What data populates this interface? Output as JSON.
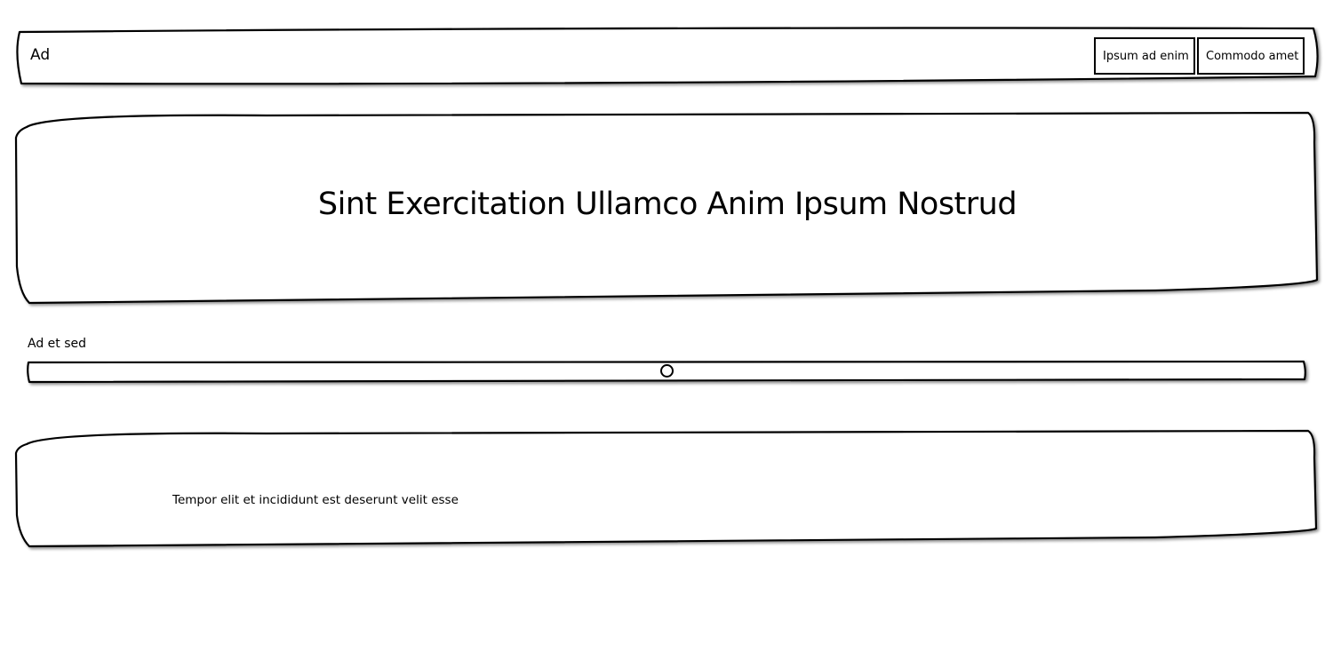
{
  "navbar": {
    "brand": "Ad",
    "buttons": [
      {
        "label": "Ipsum ad enim"
      },
      {
        "label": "Commodo amet"
      }
    ]
  },
  "hero": {
    "title": "Sint Exercitation Ullamco Anim Ipsum Nostrud"
  },
  "slider": {
    "label": "Ad et sed",
    "value": 0.5
  },
  "card": {
    "text": "Tempor elit et incididunt est deserunt velit esse"
  }
}
